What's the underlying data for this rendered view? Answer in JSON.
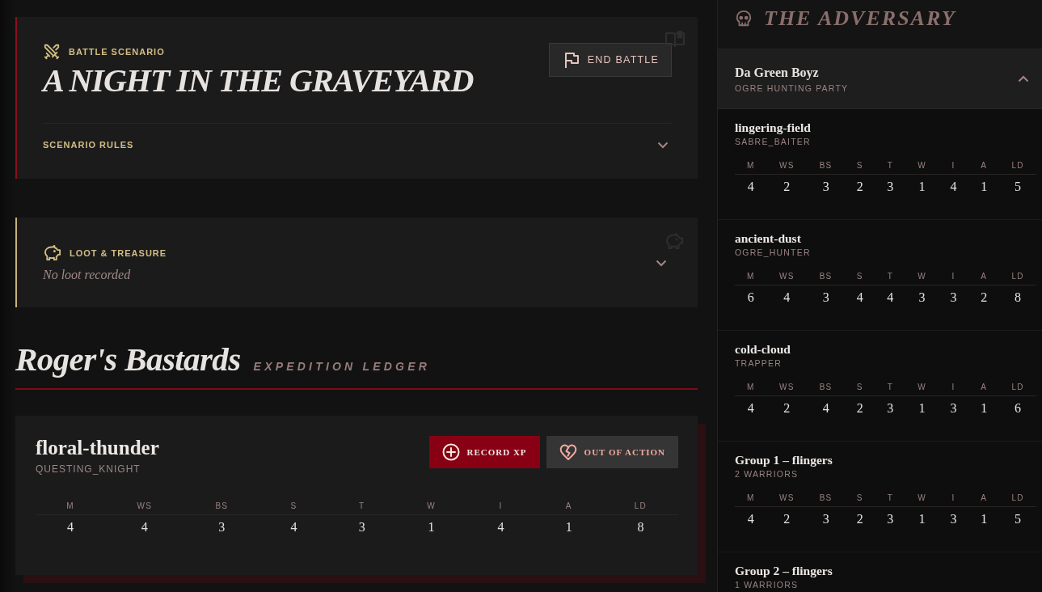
{
  "scenario": {
    "label": "BATTLE SCENARIO",
    "title": "A NIGHT IN THE GRAVEYARD",
    "end_button": "END BATTLE",
    "rules_label": "SCENARIO RULES",
    "rules_expanded": false
  },
  "loot": {
    "label": "LOOT & TREASURE",
    "empty_text": "No loot recorded",
    "expanded": false
  },
  "warband": {
    "name": "Roger's Bastards",
    "subtitle": "EXPEDITION LEDGER"
  },
  "warriors": [
    {
      "name": "floral-thunder",
      "type": "QUESTING_KNIGHT",
      "buttons": [
        {
          "kind": "record",
          "label": "RECORD XP"
        },
        {
          "kind": "out_of_action",
          "label": "OUT OF ACTION"
        }
      ],
      "stats": [
        {
          "label": "M",
          "value": "4"
        },
        {
          "label": "WS",
          "value": "4"
        },
        {
          "label": "BS",
          "value": "3"
        },
        {
          "label": "S",
          "value": "4"
        },
        {
          "label": "T",
          "value": "3"
        },
        {
          "label": "W",
          "value": "1"
        },
        {
          "label": "I",
          "value": "4"
        },
        {
          "label": "A",
          "value": "1"
        },
        {
          "label": "LD",
          "value": "8"
        }
      ]
    }
  ],
  "adversary": {
    "title": "THE ADVERSARY",
    "groups": [
      {
        "name": "Da Green Boyz",
        "subtitle": "OGRE HUNTING PARTY",
        "expanded": true,
        "members": [
          {
            "name": "lingering-field",
            "type": "SABRE_BAITER",
            "stats": [
              {
                "label": "M",
                "value": "4"
              },
              {
                "label": "WS",
                "value": "2"
              },
              {
                "label": "BS",
                "value": "3"
              },
              {
                "label": "S",
                "value": "2"
              },
              {
                "label": "T",
                "value": "3"
              },
              {
                "label": "W",
                "value": "1"
              },
              {
                "label": "I",
                "value": "4"
              },
              {
                "label": "A",
                "value": "1"
              },
              {
                "label": "LD",
                "value": "5"
              }
            ]
          },
          {
            "name": "ancient-dust",
            "type": "OGRE_HUNTER",
            "stats": [
              {
                "label": "M",
                "value": "6"
              },
              {
                "label": "WS",
                "value": "4"
              },
              {
                "label": "BS",
                "value": "3"
              },
              {
                "label": "S",
                "value": "4"
              },
              {
                "label": "T",
                "value": "4"
              },
              {
                "label": "W",
                "value": "3"
              },
              {
                "label": "I",
                "value": "3"
              },
              {
                "label": "A",
                "value": "2"
              },
              {
                "label": "LD",
                "value": "8"
              }
            ]
          },
          {
            "name": "cold-cloud",
            "type": "TRAPPER",
            "stats": [
              {
                "label": "M",
                "value": "4"
              },
              {
                "label": "WS",
                "value": "2"
              },
              {
                "label": "BS",
                "value": "4"
              },
              {
                "label": "S",
                "value": "2"
              },
              {
                "label": "T",
                "value": "3"
              },
              {
                "label": "W",
                "value": "1"
              },
              {
                "label": "I",
                "value": "3"
              },
              {
                "label": "A",
                "value": "1"
              },
              {
                "label": "LD",
                "value": "6"
              }
            ]
          },
          {
            "name": "Group 1 – flingers",
            "type": "2 WARRIORS",
            "stats": [
              {
                "label": "M",
                "value": "4"
              },
              {
                "label": "WS",
                "value": "2"
              },
              {
                "label": "BS",
                "value": "3"
              },
              {
                "label": "S",
                "value": "2"
              },
              {
                "label": "T",
                "value": "3"
              },
              {
                "label": "W",
                "value": "1"
              },
              {
                "label": "I",
                "value": "3"
              },
              {
                "label": "A",
                "value": "1"
              },
              {
                "label": "LD",
                "value": "5"
              }
            ]
          },
          {
            "name": "Group 2 – flingers",
            "type": "1 WARRIORS"
          }
        ]
      }
    ]
  }
}
